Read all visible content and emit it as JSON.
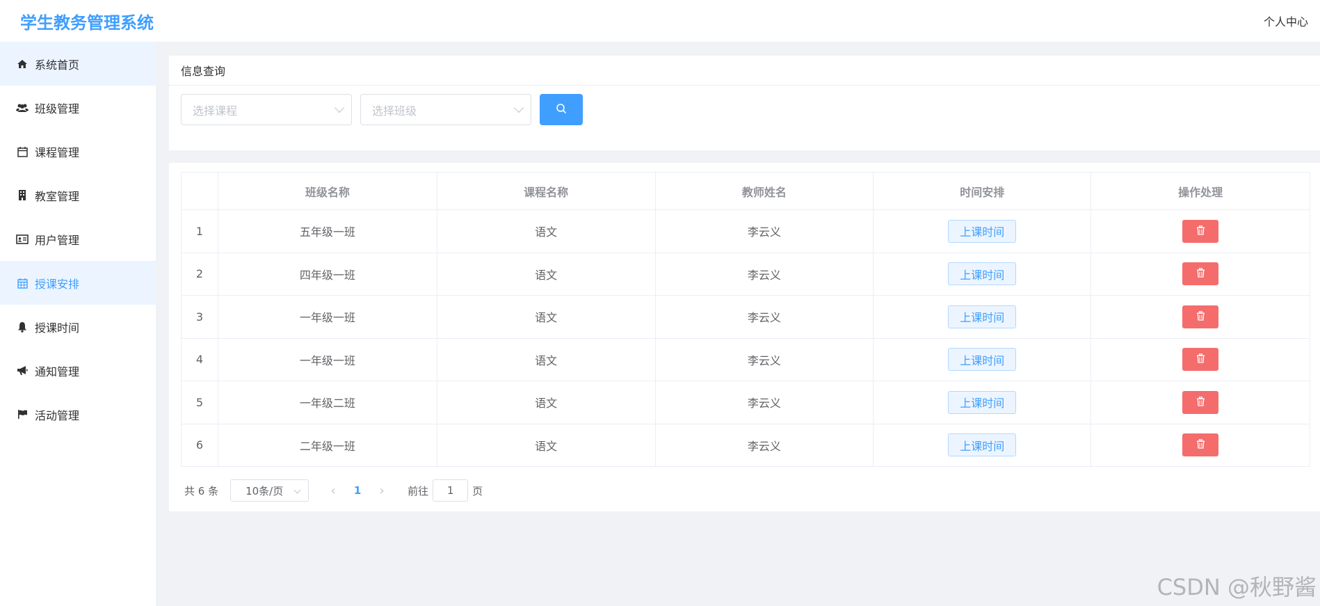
{
  "app": {
    "title": "学生教务管理系统",
    "user_center": "个人中心"
  },
  "sidebar": {
    "items": [
      {
        "label": "系统首页",
        "icon": "home-icon"
      },
      {
        "label": "班级管理",
        "icon": "users-icon"
      },
      {
        "label": "课程管理",
        "icon": "calendar-icon"
      },
      {
        "label": "教室管理",
        "icon": "building-icon"
      },
      {
        "label": "用户管理",
        "icon": "id-card-icon"
      },
      {
        "label": "授课安排",
        "icon": "calendar-grid-icon",
        "active": true
      },
      {
        "label": "授课时间",
        "icon": "bell-icon"
      },
      {
        "label": "通知管理",
        "icon": "megaphone-icon"
      },
      {
        "label": "活动管理",
        "icon": "flag-icon"
      }
    ]
  },
  "search": {
    "title": "信息查询",
    "course_placeholder": "选择课程",
    "class_placeholder": "选择班级"
  },
  "table": {
    "columns": [
      "",
      "班级名称",
      "课程名称",
      "教师姓名",
      "时间安排",
      "操作处理"
    ],
    "time_button_label": "上课时间",
    "rows": [
      {
        "index": "1",
        "class_name": "五年级一班",
        "course": "语文",
        "teacher": "李云义"
      },
      {
        "index": "2",
        "class_name": "四年级一班",
        "course": "语文",
        "teacher": "李云义"
      },
      {
        "index": "3",
        "class_name": "一年级一班",
        "course": "语文",
        "teacher": "李云义"
      },
      {
        "index": "4",
        "class_name": "一年级一班",
        "course": "语文",
        "teacher": "李云义"
      },
      {
        "index": "5",
        "class_name": "一年级二班",
        "course": "语文",
        "teacher": "李云义"
      },
      {
        "index": "6",
        "class_name": "二年级一班",
        "course": "语文",
        "teacher": "李云义"
      }
    ]
  },
  "pagination": {
    "total_text": "共 6 条",
    "page_size": "10条/页",
    "current_page": "1",
    "goto_label": "前往",
    "goto_value": "1",
    "page_suffix": "页"
  },
  "watermark": "CSDN @秋野酱",
  "colors": {
    "primary": "#409eff",
    "danger": "#f56c6c",
    "active_bg": "#ecf5ff"
  }
}
